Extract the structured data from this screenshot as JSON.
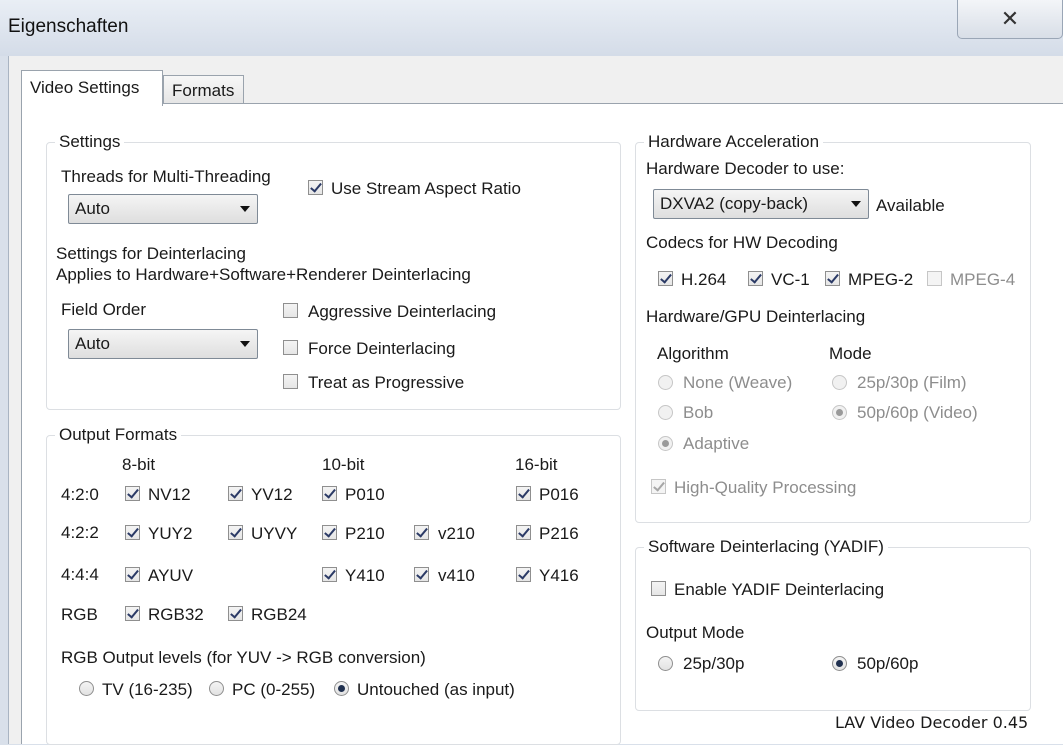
{
  "window": {
    "title": "Eigenschaften",
    "close_glyph": "✕"
  },
  "tabs": [
    {
      "label": "Video Settings",
      "active": true
    },
    {
      "label": "Formats",
      "active": false
    }
  ],
  "settings": {
    "group_label": "Settings",
    "threads_label": "Threads for Multi-Threading",
    "threads_value": "Auto",
    "use_stream_aspect_label": "Use Stream Aspect Ratio",
    "deint_heading": "Settings for Deinterlacing",
    "deint_sub": "Applies to Hardware+Software+Renderer Deinterlacing",
    "field_order_label": "Field Order",
    "field_order_value": "Auto",
    "aggressive_label": "Aggressive Deinterlacing",
    "force_label": "Force Deinterlacing",
    "progressive_label": "Treat as Progressive"
  },
  "output_formats": {
    "group_label": "Output Formats",
    "col_8bit": "8-bit",
    "col_10bit": "10-bit",
    "col_16bit": "16-bit",
    "row_420": "4:2:0",
    "row_422": "4:2:2",
    "row_444": "4:4:4",
    "row_rgb": "RGB",
    "nv12": "NV12",
    "yv12": "YV12",
    "p010": "P010",
    "p016": "P016",
    "yuy2": "YUY2",
    "uyvy": "UYVY",
    "p210": "P210",
    "v210": "v210",
    "p216": "P216",
    "ayuv": "AYUV",
    "y410": "Y410",
    "v410": "v410",
    "y416": "Y416",
    "rgb32": "RGB32",
    "rgb24": "RGB24",
    "levels_label": "RGB Output levels (for YUV -> RGB conversion)",
    "level_tv": "TV (16-235)",
    "level_pc": "PC (0-255)",
    "level_untouched": "Untouched (as input)"
  },
  "hw": {
    "group_label": "Hardware Acceleration",
    "decoder_label": "Hardware Decoder to use:",
    "decoder_value": "DXVA2 (copy-back)",
    "status": "Available",
    "codecs_label": "Codecs for HW Decoding",
    "h264": "H.264",
    "vc1": "VC-1",
    "mpeg2": "MPEG-2",
    "mpeg4": "MPEG-4",
    "gpu_deint_label": "Hardware/GPU Deinterlacing",
    "algorithm_label": "Algorithm",
    "mode_label": "Mode",
    "alg_none": "None (Weave)",
    "alg_bob": "Bob",
    "alg_adaptive": "Adaptive",
    "mode_film": "25p/30p (Film)",
    "mode_video": "50p/60p (Video)",
    "hq_label": "High-Quality Processing"
  },
  "sw": {
    "group_label": "Software Deinterlacing (YADIF)",
    "enable_label": "Enable YADIF Deinterlacing",
    "output_mode_label": "Output Mode",
    "mode_25": "25p/30p",
    "mode_50": "50p/60p"
  },
  "footer": {
    "version": "LAV Video Decoder 0.45"
  }
}
